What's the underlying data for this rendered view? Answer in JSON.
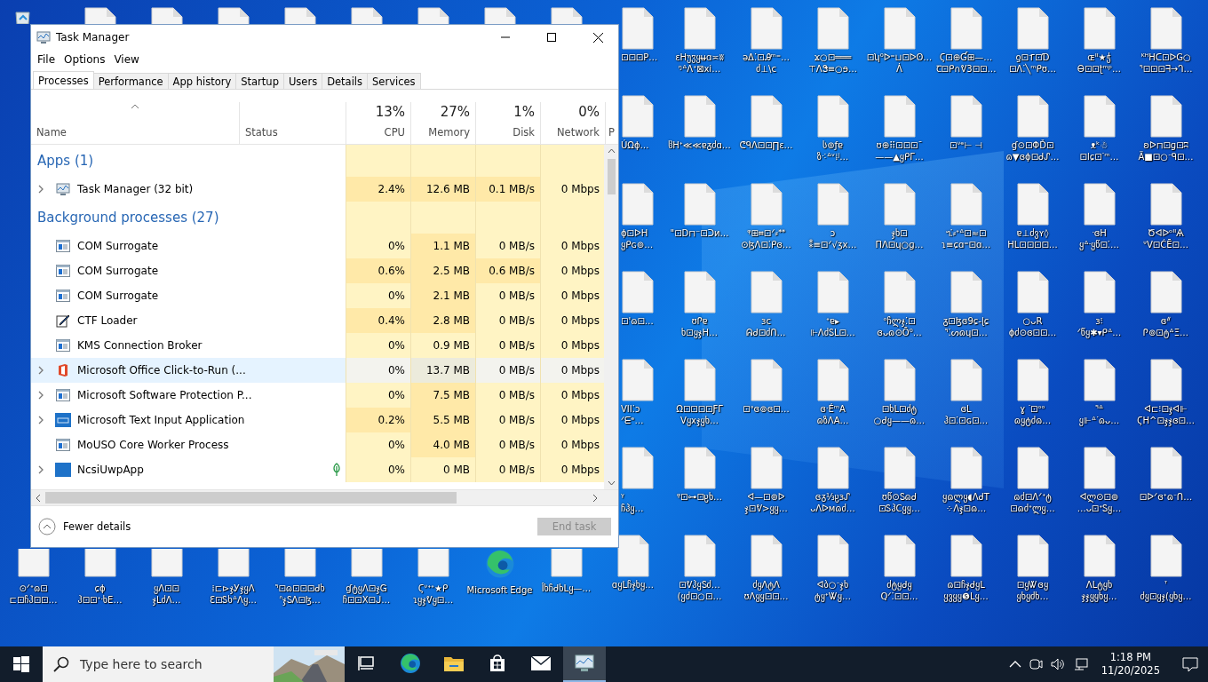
{
  "desktop": {
    "rows": [
      [
        {
          "kind": "recycle-peek"
        },
        {
          "kind": "file-peek"
        },
        {
          "kind": "file-peek"
        },
        {
          "kind": "file-peek"
        },
        {
          "kind": "file-peek"
        },
        {
          "kind": "file-peek"
        },
        {
          "kind": "file-peek"
        },
        {
          "kind": "file-peek"
        },
        {
          "kind": "file-peek"
        },
        {
          "kind": "file-cut",
          "label": "⊡⊡⊡P…"
        },
        {
          "kind": "file",
          "label": "ɛᕼუჳყʉɑ≍ʬ\nᵑᐞɅᐩ⊠xi…"
        },
        {
          "kind": "file",
          "label": "ǝΔ⁚⊡Ꭿᵐ⁼…\nძ⊥\\ϲ"
        },
        {
          "kind": "file",
          "label": "ϫ○⊡═══\n⊤ᐱᏕ≡○ɘ…"
        },
        {
          "kind": "file",
          "label": "⊡ʮ⁰ᐅ⁼⊔⊡ᐅʘ…\nᐲ"
        },
        {
          "kind": "file",
          "label": "Ϛ⊡⊕Ɠ⊞—…\nꞆ⊡ᑭ∩ᕓ3⊡⊡…"
        },
        {
          "kind": "file",
          "label": "ƍ⊡ፐ⊡Ɗ\n⊡Ʌ⁚╲ᵐᑭʊ…"
        },
        {
          "kind": "file",
          "label": "ɶᐦ★ჭ\nᎾ⊡⊡ʈᵐᵖ…"
        },
        {
          "kind": "file",
          "label": "ᴷᴴᕼᑕ⊡ᐅG○\nᕐ⊡⊡⊡ᖷ→ᒉ…"
        }
      ],
      [
        {
          "kind": "hidden"
        },
        {
          "kind": "hidden"
        },
        {
          "kind": "hidden"
        },
        {
          "kind": "hidden"
        },
        {
          "kind": "hidden"
        },
        {
          "kind": "hidden"
        },
        {
          "kind": "hidden"
        },
        {
          "kind": "hidden"
        },
        {
          "kind": "hidden"
        },
        {
          "kind": "file-cut",
          "label": "ÚΩɸ…"
        },
        {
          "kind": "file",
          "label": "ჱᕼᐩ≪≪ɐᵹძɑ…"
        },
        {
          "kind": "file",
          "label": "ᕦᑫɅ⊡⊡∏ɛ…"
        },
        {
          "kind": "file",
          "label": "ს⊚ƒɐ\nზ⁖ᐞᵛ⁞ʲ…"
        },
        {
          "kind": "file",
          "label": "ʊ⊕⠿⊡⊡⊡ˉ\n——▲ყᑭΓ…"
        },
        {
          "kind": "file",
          "label": "⊡ᐡᵉ⊢ ⊣"
        },
        {
          "kind": "file",
          "label": "ɠ⊙⊡ΦĎ⊡\nɷ▼ɞɸ⊡ᑯᔑ…"
        },
        {
          "kind": "file",
          "label": "ᴥᵏ☃\n⊡ⅼɕ⊡ᐝᵐ…"
        },
        {
          "kind": "file",
          "label": "ʚᐅ⊓⊡ɡ⊡ʭ\nÄ■⊡○ᐨᑫ⊡…"
        }
      ],
      [
        {
          "kind": "hidden"
        },
        {
          "kind": "hidden"
        },
        {
          "kind": "hidden"
        },
        {
          "kind": "hidden"
        },
        {
          "kind": "hidden"
        },
        {
          "kind": "hidden"
        },
        {
          "kind": "hidden"
        },
        {
          "kind": "hidden"
        },
        {
          "kind": "hidden"
        },
        {
          "kind": "file-cut",
          "label": "ɸ⊡ᐅᕼ\nყᑭɢ⊚…"
        },
        {
          "kind": "file",
          "label": "\"⊡D⊓⁻⊡ᑐᴎ…"
        },
        {
          "kind": "file",
          "label": "ᵠ⊞⌗⊡ᐟ⸗ᕯ\n⊙ɮᐱ⊡⁚ᑭɞ…"
        },
        {
          "kind": "file",
          "label": "ɔ\n⁑≡⊡ᐟ√ʒx…"
        },
        {
          "kind": "file",
          "label": "ჯხ⊡\nΠᐱ⊡ɥ○ɡ…"
        },
        {
          "kind": "file",
          "label": "ᥐ⁚⸗ᐩᐞ⊡≈⊡\nɿ≡ɕɑ⁼⊡ɑ…"
        },
        {
          "kind": "file",
          "label": "ɐ⊥ძვʏ◊\nᕼᒪ⊡⊡⊡⊡…"
        },
        {
          "kind": "file",
          "label": "ᐧɞᕼ\nყᐞᐧყწ⊡⁚…"
        },
        {
          "kind": "file",
          "label": "ԾᐊᐅᵒᐦѦ\nᐡᐯ⊡ĆĒ⊡…"
        }
      ],
      [
        {
          "kind": "hidden"
        },
        {
          "kind": "hidden"
        },
        {
          "kind": "hidden"
        },
        {
          "kind": "hidden"
        },
        {
          "kind": "hidden"
        },
        {
          "kind": "hidden"
        },
        {
          "kind": "hidden"
        },
        {
          "kind": "hidden"
        },
        {
          "kind": "hidden"
        },
        {
          "kind": "file-cut",
          "label": "⊡'ɷ⊡…"
        },
        {
          "kind": "file",
          "label": "ʊᎵɐ\nხ⊡ყჯH…"
        },
        {
          "kind": "file",
          "label": "ɜc\nᕱᑯ⊡ძᑎ…"
        },
        {
          "kind": "file",
          "label": "ᐩɐ▸\n⊩ᐱძᏚᒪ⊡…"
        },
        {
          "kind": "file",
          "label": "ᵒჩლჯ⁚⊡\nɞᴗɷ⊙Ō⁰…"
        },
        {
          "kind": "file",
          "label": "ᵹ⊡ɮɞ9ɕ-ɭɕ\nᕐ⁚ᔕɷɥ⊡…"
        },
        {
          "kind": "file",
          "label": "○ᴗR\nɸძ⊙ɞ⊡⊡…"
        },
        {
          "kind": "file",
          "label": "ɜ⁝\nᐟწყ✱▾ᑭᐞ…"
        },
        {
          "kind": "file",
          "label": "ɞᐥ\nᎵ⊚⊡ტᐞΞ…"
        }
      ],
      [
        {
          "kind": "hidden"
        },
        {
          "kind": "hidden"
        },
        {
          "kind": "hidden"
        },
        {
          "kind": "hidden"
        },
        {
          "kind": "hidden"
        },
        {
          "kind": "hidden"
        },
        {
          "kind": "hidden"
        },
        {
          "kind": "hidden"
        },
        {
          "kind": "hidden"
        },
        {
          "kind": "file-cut",
          "label": "VII⁚ɔ\nᐟᗴᵉ…"
        },
        {
          "kind": "file",
          "label": "Ω⊡⊡⊡⊡ƑΓ\nᐯყxჯყხ…"
        },
        {
          "kind": "file",
          "label": "⊡ᐤɞ⊚ɞ⊡…"
        },
        {
          "kind": "file",
          "label": "ɞᐧÉᵐA\nɷზᐱA…"
        },
        {
          "kind": "file",
          "label": "⊡ხᒪ⊡ძტ\n○ᑯყ——ɷ…"
        },
        {
          "kind": "file",
          "label": "ɞᒪ\nჰ⊡⁚⊡ɢ⊡…"
        },
        {
          "kind": "file",
          "label": "ɣ ᐝ⊡ᵒᵒ\nɷყტძɷ…"
        },
        {
          "kind": "file",
          "label": "ᕐᐞ\nყ⊩ᐞᐝɷᴗ…"
        },
        {
          "kind": "file",
          "label": "ᐊ⊏⁝⊡ჯᐊ⊩\nϚH^⊡ჯჯɞ⊡…"
        }
      ],
      [
        {
          "kind": "hidden"
        },
        {
          "kind": "hidden"
        },
        {
          "kind": "hidden"
        },
        {
          "kind": "hidden"
        },
        {
          "kind": "hidden"
        },
        {
          "kind": "hidden"
        },
        {
          "kind": "hidden"
        },
        {
          "kind": "hidden"
        },
        {
          "kind": "hidden"
        },
        {
          "kind": "file-cut",
          "label": "ᵞ\nჩჰყ…"
        },
        {
          "kind": "file",
          "label": "ᵠ⊡⊶⊡ჸხ…"
        },
        {
          "kind": "file",
          "label": "ᐊ—⊡⊚ᐅ\nჯ⊡ᕓ>ყყ…"
        },
        {
          "kind": "file",
          "label": "ɞᵹ⅓ჸɜᔑ\nᴗᐱᐅᴍɷძ…"
        },
        {
          "kind": "file",
          "label": "ʊწ⊙Ꮪɷᑯ\n⊡ᏚჰCყყ…"
        },
        {
          "kind": "file",
          "label": "ყɷლყ◖ᐱᑯT\n⁘ᐱჯ⊡ɷ…"
        },
        {
          "kind": "file",
          "label": "ɷძ⊡ᐱᐟᐩტ\n⊡ɷძᐩლყ…"
        },
        {
          "kind": "file",
          "label": "ᐊლ⊙⊡⊚\n…ᴗ⊡ᐩᏚყ…"
        },
        {
          "kind": "file",
          "label": "⊡ᐅᐟɞᐩɷᐨᑎ…"
        }
      ],
      [
        {
          "kind": "file-low",
          "label": "⊙ᐟᐩɷ⊡\n⊏⊡ჩჰ⊡⊡…"
        },
        {
          "kind": "file-low",
          "label": "ɕɸ\nჰ⊡⊡ᐩᐧხE…"
        },
        {
          "kind": "file-low",
          "label": "ყᐱ⊡⊡\nჯᒪძᐱ…"
        },
        {
          "kind": "file-low",
          "label": "⁞⊏⊳ჯᎩჯყᐱ\nƐ⊡Ꮪხᐞᐱყ…"
        },
        {
          "kind": "file-low",
          "label": "ᕐ⊡ɷ⊡⊡⊡ᑯხ\nᐢჯᏚᐱ⊡ɮ…"
        },
        {
          "kind": "file-low",
          "label": "ɠტყᐱ⊡ჯᏀ\nჩ⊡⊡Χ⊡ᒍ…"
        },
        {
          "kind": "file-low",
          "label": "Ϛᐡᐩᐩ★ᑭ\nɿყჯᕓყ⊡…"
        },
        {
          "kind": "edge",
          "label": "Microsoft Edge"
        },
        {
          "kind": "file-low",
          "label": "Îხჩᑯხᒪყ—…"
        },
        {
          "kind": "file",
          "label": "ɑყᒪჩჯხყ…"
        },
        {
          "kind": "file",
          "label": "⊡ᕓჰყᏚძ…\n(ყძ⊡○⊡…"
        },
        {
          "kind": "file",
          "label": "ძყᐱტᐱ\nʊᐱყყ⊡⊡…"
        },
        {
          "kind": "file",
          "label": "ᐊბ○ᐨჯხ\nტყᐩᏔყ…"
        },
        {
          "kind": "file",
          "label": "ძტყᑯყ\nQᐟ⁚⊡⊡…"
        },
        {
          "kind": "file",
          "label": "ɷ⊡ჩჯᑯყᒪ\nყვყყ❺ᒪყ…"
        },
        {
          "kind": "file",
          "label": "⊡ყᏔɞყ\nყხყძხ…"
        },
        {
          "kind": "file",
          "label": "ᐱᒪტყხ\nჯჯყყხყ…"
        },
        {
          "kind": "file",
          "label": "ᐪ\nძყ⊡ყჯ(ყხყ…"
        }
      ]
    ]
  },
  "task_manager": {
    "title": "Task Manager",
    "menu": [
      "File",
      "Options",
      "View"
    ],
    "tabs": [
      {
        "label": "Processes",
        "selected": true
      },
      {
        "label": "Performance",
        "selected": false
      },
      {
        "label": "App history",
        "selected": false
      },
      {
        "label": "Startup",
        "selected": false
      },
      {
        "label": "Users",
        "selected": false
      },
      {
        "label": "Details",
        "selected": false
      },
      {
        "label": "Services",
        "selected": false
      }
    ],
    "columns": [
      {
        "label": "Name",
        "sorted": true
      },
      {
        "label": "Status",
        "sorted": false
      },
      {
        "label": "CPU",
        "usage": "13%",
        "sorted": false
      },
      {
        "label": "Memory",
        "usage": "27%",
        "sorted": false
      },
      {
        "label": "Disk",
        "usage": "1%",
        "sorted": false
      },
      {
        "label": "Network",
        "usage": "0%",
        "sorted": false
      },
      {
        "label": "P",
        "sorted": false
      }
    ],
    "groups": [
      {
        "title": "Apps (1)",
        "rows": [
          {
            "name": "Task Manager (32 bit)",
            "kind": "taskmgr",
            "expandable": true,
            "selected": false,
            "suspended": false,
            "cells": [
              {
                "text": "2.4%",
                "hot": true
              },
              {
                "text": "12.6 MB",
                "hot": true
              },
              {
                "text": "0.1 MB/s",
                "hot": true
              },
              {
                "text": "0 Mbps",
                "hot": false
              }
            ]
          }
        ]
      },
      {
        "title": "Background processes (27)",
        "rows": [
          {
            "name": "COM Surrogate",
            "kind": "window",
            "expandable": false,
            "selected": false,
            "suspended": false,
            "cells": [
              {
                "text": "0%",
                "hot": false
              },
              {
                "text": "1.1 MB",
                "hot": true
              },
              {
                "text": "0 MB/s",
                "hot": false
              },
              {
                "text": "0 Mbps",
                "hot": false
              }
            ]
          },
          {
            "name": "COM Surrogate",
            "kind": "window",
            "expandable": false,
            "selected": false,
            "suspended": false,
            "cells": [
              {
                "text": "0.6%",
                "hot": true
              },
              {
                "text": "2.5 MB",
                "hot": true
              },
              {
                "text": "0.6 MB/s",
                "hot": true
              },
              {
                "text": "0 Mbps",
                "hot": false
              }
            ]
          },
          {
            "name": "COM Surrogate",
            "kind": "window",
            "expandable": false,
            "selected": false,
            "suspended": false,
            "cells": [
              {
                "text": "0%",
                "hot": false
              },
              {
                "text": "2.1 MB",
                "hot": true
              },
              {
                "text": "0 MB/s",
                "hot": false
              },
              {
                "text": "0 Mbps",
                "hot": false
              }
            ]
          },
          {
            "name": "CTF Loader",
            "kind": "pen",
            "expandable": false,
            "selected": false,
            "suspended": false,
            "cells": [
              {
                "text": "0.4%",
                "hot": true
              },
              {
                "text": "2.8 MB",
                "hot": true
              },
              {
                "text": "0 MB/s",
                "hot": false
              },
              {
                "text": "0 Mbps",
                "hot": false
              }
            ]
          },
          {
            "name": "KMS Connection Broker",
            "kind": "window",
            "expandable": false,
            "selected": false,
            "suspended": false,
            "cells": [
              {
                "text": "0%",
                "hot": false
              },
              {
                "text": "0.9 MB",
                "hot": false
              },
              {
                "text": "0 MB/s",
                "hot": false
              },
              {
                "text": "0 Mbps",
                "hot": false
              }
            ]
          },
          {
            "name": "Microsoft Office Click-to-Run (...",
            "kind": "office",
            "expandable": true,
            "selected": true,
            "suspended": false,
            "cells": [
              {
                "text": "0%",
                "hot": false
              },
              {
                "text": "13.7 MB",
                "hot": true
              },
              {
                "text": "0 MB/s",
                "hot": false
              },
              {
                "text": "0 Mbps",
                "hot": false
              }
            ]
          },
          {
            "name": "Microsoft Software Protection P...",
            "kind": "window",
            "expandable": true,
            "selected": false,
            "suspended": false,
            "cells": [
              {
                "text": "0%",
                "hot": false
              },
              {
                "text": "7.5 MB",
                "hot": true
              },
              {
                "text": "0 MB/s",
                "hot": false
              },
              {
                "text": "0 Mbps",
                "hot": false
              }
            ]
          },
          {
            "name": "Microsoft Text Input Application",
            "kind": "keyboard",
            "expandable": true,
            "selected": false,
            "suspended": false,
            "cells": [
              {
                "text": "0.2%",
                "hot": true
              },
              {
                "text": "5.5 MB",
                "hot": true
              },
              {
                "text": "0 MB/s",
                "hot": false
              },
              {
                "text": "0 Mbps",
                "hot": false
              }
            ]
          },
          {
            "name": "MoUSO Core Worker Process",
            "kind": "window",
            "expandable": false,
            "selected": false,
            "suspended": false,
            "cells": [
              {
                "text": "0%",
                "hot": false
              },
              {
                "text": "4.0 MB",
                "hot": true
              },
              {
                "text": "0 MB/s",
                "hot": false
              },
              {
                "text": "0 Mbps",
                "hot": false
              }
            ]
          },
          {
            "name": "NcsiUwpApp",
            "kind": "square",
            "expandable": true,
            "selected": false,
            "suspended": true,
            "cells": [
              {
                "text": "0%",
                "hot": false
              },
              {
                "text": "0 MB",
                "hot": false
              },
              {
                "text": "0 MB/s",
                "hot": false
              },
              {
                "text": "0 Mbps",
                "hot": false
              }
            ]
          }
        ]
      }
    ],
    "fewer_details": "Fewer details",
    "end_task": {
      "label": "End task",
      "disabled": true
    }
  },
  "taskbar": {
    "search": {
      "placeholder": "Type here to search"
    },
    "apps": [
      {
        "kind": "task-view",
        "active": false
      },
      {
        "kind": "edge",
        "active": false
      },
      {
        "kind": "folder",
        "active": false
      },
      {
        "kind": "store",
        "active": false
      },
      {
        "kind": "mail",
        "active": false
      },
      {
        "kind": "taskmgr",
        "active": true
      }
    ],
    "time": "1:18 PM",
    "date": "11/20/2025"
  }
}
